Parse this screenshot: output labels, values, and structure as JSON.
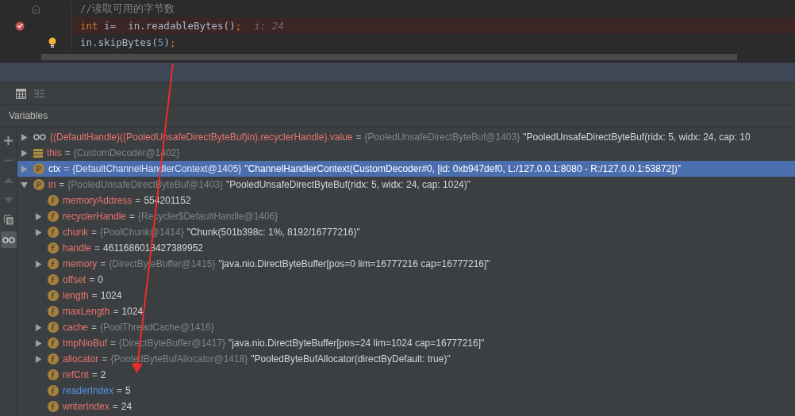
{
  "editor": {
    "lines": [
      {
        "kind": "fold",
        "highlighted": false,
        "tokens": [
          {
            "kind": "comment",
            "text": "//读取可用的字节数"
          }
        ]
      },
      {
        "kind": "breakpoint",
        "highlighted": true,
        "tokens": [
          {
            "kind": "keyword",
            "text": "int"
          },
          {
            "kind": "plain",
            "text": " i=  in.readableBytes()"
          },
          {
            "kind": "punct",
            "text": ";"
          }
        ],
        "hint": "i: 24"
      },
      {
        "kind": "bulb",
        "highlighted": false,
        "tokens": [
          {
            "kind": "plain",
            "text": "in.skipBytes("
          },
          {
            "kind": "number",
            "text": "5"
          },
          {
            "kind": "plain",
            "text": ")"
          },
          {
            "kind": "punct",
            "text": ";"
          }
        ]
      }
    ]
  },
  "panel": {
    "title": "Variables"
  },
  "side_tools": [
    {
      "kind": "plus",
      "selected": false
    },
    {
      "kind": "minus",
      "selected": false
    },
    {
      "kind": "up",
      "selected": false
    },
    {
      "kind": "down",
      "selected": false
    },
    {
      "kind": "copy",
      "selected": false
    },
    {
      "kind": "watch",
      "selected": true
    }
  ],
  "variables": [
    {
      "kind": "watch",
      "expanded": false,
      "selected": false,
      "changed": false,
      "name": "((DefaultHandle)((PooledUnsafeDirectByteBuf)in).recyclerHandle).value",
      "operator": "=",
      "type": "{PooledUnsafeDirectByteBuf@1403}",
      "value": "\"PooledUnsafeDirectByteBuf(ridx: 5, widx: 24, cap: 10"
    },
    {
      "kind": "fields",
      "expanded": false,
      "selected": false,
      "changed": false,
      "name": "this",
      "operator": "=",
      "type": "{CustomDecoder@1402}"
    },
    {
      "kind": "p",
      "expanded": false,
      "selected": true,
      "changed": false,
      "name": "ctx",
      "operator": "=",
      "type": "{DefaultChannelHandlerContext@1405}",
      "value": "\"ChannelHandlerContext(CustomDecoder#0, [id: 0xb947def0, L:/127.0.0.1:8080 - R:/127.0.0.1:53872])\""
    },
    {
      "kind": "p",
      "expanded": true,
      "selected": false,
      "changed": false,
      "name": "in",
      "operator": "=",
      "type": "{PooledUnsafeDirectByteBuf@1403}",
      "value": "\"PooledUnsafeDirectByteBuf(ridx: 5, widx: 24, cap: 1024)\"",
      "children": [
        {
          "kind": "f",
          "selected": false,
          "changed": false,
          "name": "memoryAddress",
          "operator": "=",
          "value": "554201152"
        },
        {
          "kind": "f",
          "expanded": false,
          "selected": false,
          "changed": false,
          "name": "recyclerHandle",
          "operator": "=",
          "type": "{Recycler$DefaultHandle@1406}"
        },
        {
          "kind": "f",
          "expanded": false,
          "selected": false,
          "changed": false,
          "name": "chunk",
          "operator": "=",
          "type": "{PoolChunk@1414}",
          "value": "\"Chunk(501b398c: 1%, 8192/16777216)\""
        },
        {
          "kind": "f",
          "selected": false,
          "changed": false,
          "name": "handle",
          "operator": "=",
          "value": "4611686018427389952"
        },
        {
          "kind": "f",
          "expanded": false,
          "selected": false,
          "changed": false,
          "name": "memory",
          "operator": "=",
          "type": "{DirectByteBuffer@1415}",
          "value": "\"java.nio.DirectByteBuffer[pos=0 lim=16777216 cap=16777216]\""
        },
        {
          "kind": "f",
          "selected": false,
          "changed": false,
          "name": "offset",
          "operator": "=",
          "value": "0"
        },
        {
          "kind": "f",
          "selected": false,
          "changed": false,
          "name": "length",
          "operator": "=",
          "value": "1024"
        },
        {
          "kind": "f",
          "selected": false,
          "changed": false,
          "name": "maxLength",
          "operator": "=",
          "value": "1024"
        },
        {
          "kind": "f",
          "expanded": false,
          "selected": false,
          "changed": false,
          "name": "cache",
          "operator": "=",
          "type": "{PoolThreadCache@1416}"
        },
        {
          "kind": "f",
          "expanded": false,
          "selected": false,
          "changed": false,
          "name": "tmpNioBuf",
          "operator": "=",
          "type": "{DirectByteBuffer@1417}",
          "value": "\"java.nio.DirectByteBuffer[pos=24 lim=1024 cap=16777216]\""
        },
        {
          "kind": "f",
          "expanded": false,
          "selected": false,
          "changed": false,
          "name": "allocator",
          "operator": "=",
          "type": "{PooledByteBufAllocator@1418}",
          "value": "\"PooledByteBufAllocator(directByDefault: true)\""
        },
        {
          "kind": "f",
          "selected": false,
          "changed": false,
          "name": "refCnt",
          "operator": "=",
          "value": "2"
        },
        {
          "kind": "f",
          "selected": false,
          "changed": true,
          "name": "readerIndex",
          "operator": "=",
          "value": "5"
        },
        {
          "kind": "f",
          "selected": false,
          "changed": false,
          "name": "writerIndex",
          "operator": "=",
          "value": "24"
        }
      ]
    }
  ]
}
